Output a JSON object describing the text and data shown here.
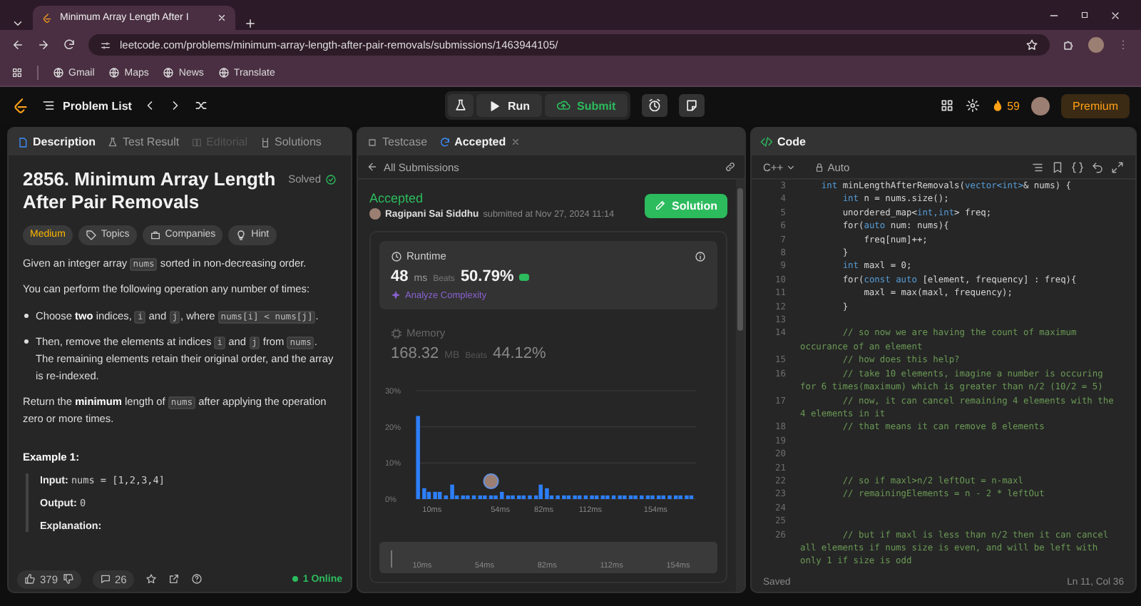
{
  "browser": {
    "tab_title": "Minimum Array Length After I",
    "url": "leetcode.com/problems/minimum-array-length-after-pair-removals/submissions/1463944105/",
    "bookmarks": [
      "Gmail",
      "Maps",
      "News",
      "Translate"
    ]
  },
  "topbar": {
    "problem_list": "Problem List",
    "run": "Run",
    "submit": "Submit",
    "streak": "59",
    "premium": "Premium"
  },
  "description_panel": {
    "tabs": [
      {
        "label": "Description",
        "selected": true,
        "disabled": false
      },
      {
        "label": "Test Result",
        "selected": false,
        "disabled": false
      },
      {
        "label": "Editorial",
        "selected": false,
        "disabled": true
      },
      {
        "label": "Solutions",
        "selected": false,
        "disabled": false
      }
    ],
    "title": "2856. Minimum Array Length After Pair Removals",
    "status": "Solved",
    "tags": [
      {
        "label": "Medium",
        "kind": "difficulty"
      },
      {
        "label": "Topics",
        "kind": "topics"
      },
      {
        "label": "Companies",
        "kind": "companies"
      },
      {
        "label": "Hint",
        "kind": "hint"
      }
    ],
    "paragraphs": [
      {
        "kind": "para",
        "segments": [
          {
            "kind": "text",
            "text": "Given an integer array "
          },
          {
            "kind": "code",
            "text": "nums"
          },
          {
            "kind": "text",
            "text": " sorted in non-decreasing order."
          }
        ]
      },
      {
        "kind": "para",
        "segments": [
          {
            "kind": "text",
            "text": "You can perform the following operation any number of times:"
          }
        ]
      },
      {
        "kind": "bullet",
        "segments": [
          {
            "kind": "text",
            "text": "Choose "
          },
          {
            "kind": "bold",
            "text": "two"
          },
          {
            "kind": "text",
            "text": " indices, "
          },
          {
            "kind": "code",
            "text": "i"
          },
          {
            "kind": "text",
            "text": " and "
          },
          {
            "kind": "code",
            "text": "j"
          },
          {
            "kind": "text",
            "text": ", where "
          },
          {
            "kind": "code",
            "text": "nums[i] < nums[j]"
          },
          {
            "kind": "text",
            "text": "."
          }
        ]
      },
      {
        "kind": "bullet",
        "segments": [
          {
            "kind": "text",
            "text": "Then, remove the elements at indices "
          },
          {
            "kind": "code",
            "text": "i"
          },
          {
            "kind": "text",
            "text": " and "
          },
          {
            "kind": "code",
            "text": "j"
          },
          {
            "kind": "text",
            "text": " from "
          },
          {
            "kind": "code",
            "text": "nums"
          },
          {
            "kind": "text",
            "text": ". The remaining elements retain their original order, and the array is re-indexed."
          }
        ]
      },
      {
        "kind": "para",
        "segments": [
          {
            "kind": "text",
            "text": "Return the "
          },
          {
            "kind": "bold",
            "text": "minimum"
          },
          {
            "kind": "text",
            "text": " length of "
          },
          {
            "kind": "code",
            "text": "nums"
          },
          {
            "kind": "text",
            "text": " after applying the operation zero or more times."
          }
        ]
      }
    ],
    "example": {
      "heading": "Example 1:",
      "lines": [
        {
          "label": "Input:",
          "value": "nums = [1,2,3,4]"
        },
        {
          "label": "Output:",
          "value": "0"
        },
        {
          "label": "Explanation:"
        }
      ]
    },
    "footer": {
      "likes": "379",
      "comments": "26",
      "online": "1 Online"
    }
  },
  "submission_panel": {
    "tabs": [
      {
        "label": "Testcase",
        "selected": false
      },
      {
        "label": "Accepted",
        "selected": true
      }
    ],
    "back_link": "All Submissions",
    "status": "Accepted",
    "author": "Ragipani Sai Siddhu",
    "submitted": "submitted at Nov 27, 2024 11:14",
    "solution_button": "Solution",
    "metrics": [
      {
        "name": "Runtime",
        "value": "48",
        "unit": "ms",
        "beats_label": "Beats",
        "beats": "50.79%",
        "selected": true,
        "action": "Analyze Complexity"
      },
      {
        "name": "Memory",
        "value": "168.32",
        "unit": "MB",
        "beats_label": "Beats",
        "beats": "44.12%",
        "selected": false
      }
    ],
    "chart_data": {
      "type": "bar",
      "x": [
        1,
        5,
        8,
        12,
        15,
        19,
        23,
        26,
        30,
        33,
        37,
        41,
        44,
        48,
        51,
        55,
        59,
        62,
        66,
        69,
        73,
        77,
        80,
        84,
        87,
        91,
        95,
        98,
        102,
        105,
        109,
        113,
        116,
        120,
        123,
        127,
        131,
        134,
        138,
        141,
        145,
        149,
        152,
        156,
        159,
        163,
        167,
        170,
        174,
        177
      ],
      "xlim": [
        0,
        180
      ],
      "values": [
        23,
        3,
        2,
        2,
        2,
        1,
        4,
        1,
        1,
        1,
        1,
        1,
        1,
        1,
        1,
        2,
        1,
        1,
        1,
        1,
        1,
        1,
        4,
        3,
        1,
        1,
        1,
        1,
        1,
        1,
        1,
        1,
        1,
        1,
        1,
        1,
        1,
        1,
        1,
        1,
        1,
        1,
        1,
        1,
        1,
        1,
        1,
        1,
        1,
        1
      ],
      "ylim": [
        0,
        30
      ],
      "yticks": [
        {
          "value": 0,
          "label": "0%"
        },
        {
          "value": 10,
          "label": "10%"
        },
        {
          "value": 20,
          "label": "20%"
        },
        {
          "value": 30,
          "label": "30%"
        }
      ],
      "xticks": [
        {
          "value": 10,
          "label": "10ms"
        },
        {
          "value": 54,
          "label": "54ms"
        },
        {
          "value": 82,
          "label": "82ms"
        },
        {
          "value": 112,
          "label": "112ms"
        },
        {
          "value": 154,
          "label": "154ms"
        }
      ]
    },
    "range": {
      "level": 1,
      "labels": [
        "10ms",
        "54ms",
        "82ms",
        "112ms",
        "154ms"
      ]
    }
  },
  "code_panel": {
    "tab": "Code",
    "language": "C++",
    "mode": "Auto",
    "lines": [
      {
        "number": "3",
        "segments": [
          {
            "kind": "keyword",
            "text": "    int"
          },
          {
            "kind": "plain",
            "text": " minLengthAfterRemovals("
          },
          {
            "kind": "keyword",
            "text": "vector<int>"
          },
          {
            "kind": "plain",
            "text": "& nums) {"
          }
        ]
      },
      {
        "number": "4",
        "segments": [
          {
            "kind": "keyword",
            "text": "        int"
          },
          {
            "kind": "plain",
            "text": " n = nums.size();"
          }
        ]
      },
      {
        "number": "5",
        "segments": [
          {
            "kind": "plain",
            "text": "        unordered_map<"
          },
          {
            "kind": "keyword",
            "text": "int,int"
          },
          {
            "kind": "plain",
            "text": "> freq;"
          }
        ]
      },
      {
        "number": "6",
        "segments": [
          {
            "kind": "plain",
            "text": "        for("
          },
          {
            "kind": "keyword",
            "text": "auto"
          },
          {
            "kind": "plain",
            "text": " num: nums){"
          }
        ]
      },
      {
        "number": "7",
        "segments": [
          {
            "kind": "plain",
            "text": "            freq[num]++;"
          }
        ]
      },
      {
        "number": "8",
        "segments": [
          {
            "kind": "plain",
            "text": "        }"
          }
        ]
      },
      {
        "number": "9",
        "segments": [
          {
            "kind": "keyword",
            "text": "        int"
          },
          {
            "kind": "plain",
            "text": " maxl = 0;"
          }
        ]
      },
      {
        "number": "10",
        "segments": [
          {
            "kind": "plain",
            "text": "        for("
          },
          {
            "kind": "keyword",
            "text": "const auto"
          },
          {
            "kind": "plain",
            "text": " [element, frequency] : freq){"
          }
        ]
      },
      {
        "number": "11",
        "segments": [
          {
            "kind": "plain",
            "text": "            maxl = max(maxl, frequency);"
          }
        ]
      },
      {
        "number": "12",
        "segments": [
          {
            "kind": "plain",
            "text": "        }"
          }
        ]
      },
      {
        "number": "13"
      },
      {
        "number": "14",
        "segments": [
          {
            "kind": "comment",
            "text": "        // so now we are having the count of maximum occurance of an element"
          }
        ]
      },
      {
        "number": "15",
        "segments": [
          {
            "kind": "comment",
            "text": "        // how does this help?"
          }
        ]
      },
      {
        "number": "16",
        "segments": [
          {
            "kind": "comment",
            "text": "        // take 10 elements, imagine a number is occuring for 6 times(maximum) which is greater than n/2 (10/2 = 5)"
          }
        ]
      },
      {
        "number": "17",
        "segments": [
          {
            "kind": "comment",
            "text": "        // now, it can cancel remaining 4 elements with the 4 elements in it"
          }
        ]
      },
      {
        "number": "18",
        "segments": [
          {
            "kind": "comment",
            "text": "        // that means it can remove 8 elements"
          }
        ]
      },
      {
        "number": "19"
      },
      {
        "number": "20"
      },
      {
        "number": "21"
      },
      {
        "number": "22",
        "segments": [
          {
            "kind": "comment",
            "text": "        // so if maxl>n/2 leftOut = n-maxl"
          }
        ]
      },
      {
        "number": "23",
        "segments": [
          {
            "kind": "comment",
            "text": "        // remainingElements = n - 2 * leftOut"
          }
        ]
      },
      {
        "number": "24"
      },
      {
        "number": "25"
      },
      {
        "number": "26",
        "segments": [
          {
            "kind": "comment",
            "text": "        // but if maxl is less than n/2 then it can cancel all elements if nums size is even, and will be left with only 1 if size is odd"
          }
        ]
      }
    ],
    "status": "Saved",
    "cursor": "Ln 11, Col 36"
  }
}
